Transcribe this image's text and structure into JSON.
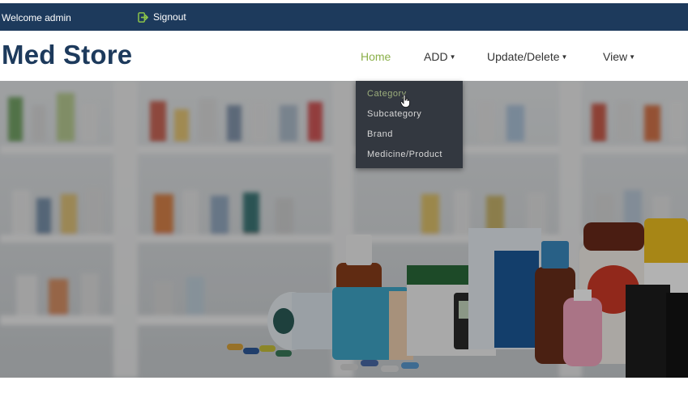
{
  "topbar": {
    "welcome": "Welcome admin",
    "signout": "Signout",
    "signout_icon": "signout-icon",
    "bg_color": "#1d3a5c"
  },
  "header": {
    "brand": "Med Store",
    "nav": {
      "home": "Home",
      "add": "ADD",
      "update_delete": "Update/Delete",
      "view": "View"
    },
    "active_color": "#8bb04a"
  },
  "dropdown": {
    "items": [
      "Category",
      "Subcategory",
      "Brand",
      "Medicine/Product"
    ]
  },
  "hero": {
    "image": "pharmacy-products-banner"
  }
}
